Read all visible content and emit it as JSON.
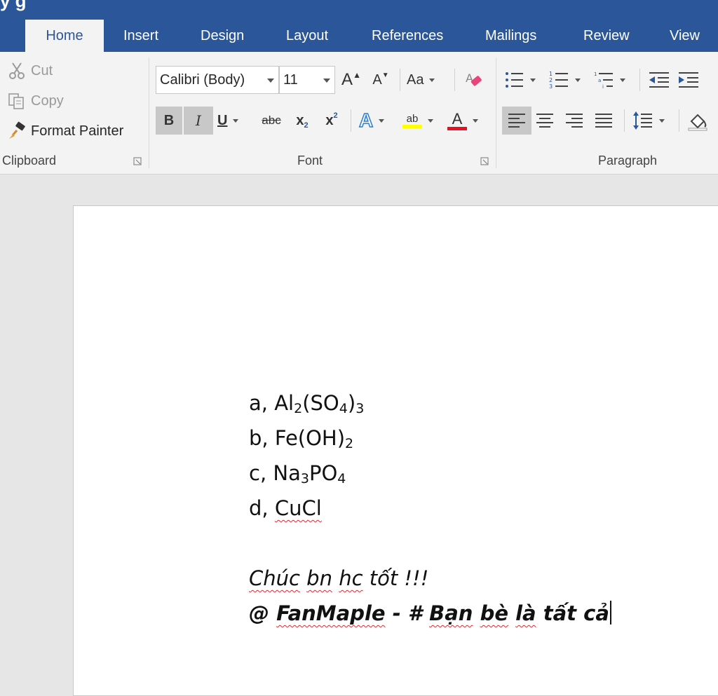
{
  "title_fragment": "y g",
  "tabs": [
    "Home",
    "Insert",
    "Design",
    "Layout",
    "References",
    "Mailings",
    "Review",
    "View"
  ],
  "clipboard": {
    "cut": "Cut",
    "copy": "Copy",
    "format_painter": "Format Painter",
    "label": "Clipboard"
  },
  "font": {
    "family": "Calibri (Body)",
    "size": "11",
    "change_case": "Aa",
    "bold": "B",
    "italic": "I",
    "underline": "U",
    "strike": "abc",
    "subscript_base": "x",
    "subscript_mark": "2",
    "superscript_base": "x",
    "superscript_mark": "2",
    "grow": "A",
    "shrink": "A",
    "text_effects": "A",
    "highlight": "ab",
    "font_color": "A",
    "label": "Font",
    "highlight_color": "#ffff00",
    "font_color_value": "#e81123"
  },
  "paragraph": {
    "label": "Paragraph"
  },
  "document": {
    "line_a_prefix": "a, Al",
    "line_a_sub1": "2",
    "line_a_mid": "(SO",
    "line_a_sub2": "4",
    "line_a_close": ")",
    "line_a_sub3": "3",
    "line_b_prefix": "b, Fe(OH)",
    "line_b_sub": "2",
    "line_c_prefix": "c, Na",
    "line_c_sub1": "3",
    "line_c_mid": "PO",
    "line_c_sub2": "4",
    "line_d_prefix": "d, ",
    "line_d_word": "CuCl",
    "wish_w1": "Chúc",
    "wish_w2": "bn",
    "wish_w3": "hc",
    "wish_rest": "tốt !!!",
    "sig_at": "@ ",
    "sig_w1": "FanMaple",
    "sig_mid": " - # ",
    "sig_w2": "Bạn",
    "sig_w3": "bè",
    "sig_w4": "là",
    "sig_w5": "tất",
    "sig_w6": "cả"
  },
  "colors": {
    "brand": "#2b579a",
    "ribbon": "#f3f3f3",
    "spell_error": "#e0282e"
  }
}
